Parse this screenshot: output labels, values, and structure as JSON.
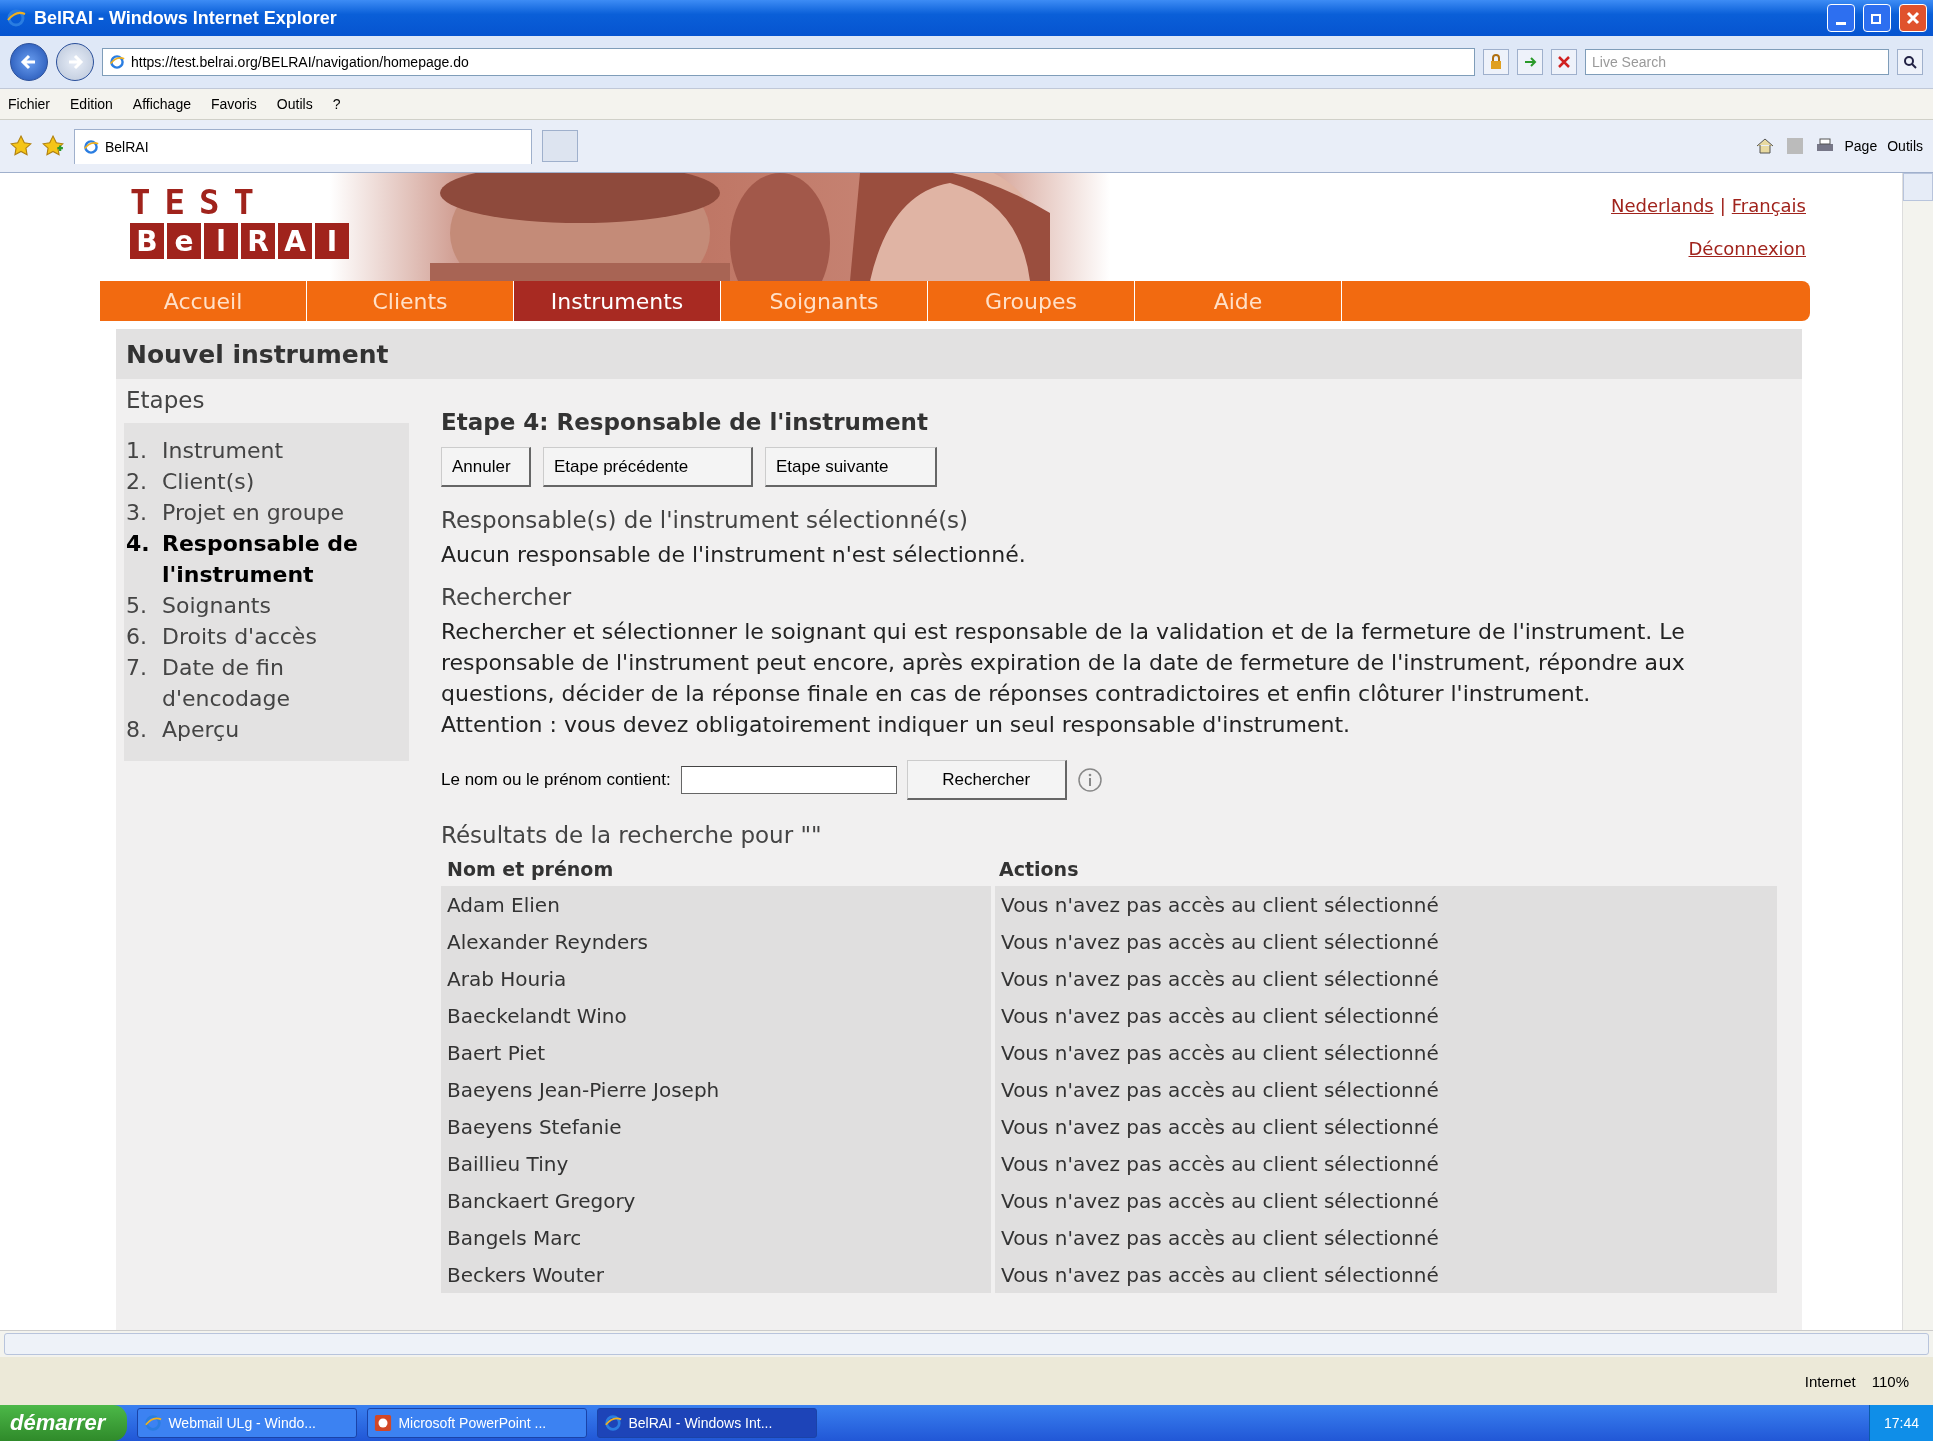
{
  "window": {
    "title": "BelRAI - Windows Internet Explorer"
  },
  "address_bar": {
    "url": "https://test.belrai.org/BELRAI/navigation/homepage.do",
    "search_placeholder": "Live Search"
  },
  "menu_bar": [
    "Fichier",
    "Edition",
    "Affichage",
    "Favoris",
    "Outils",
    "?"
  ],
  "tab": {
    "label": "BelRAI"
  },
  "command_bar": [
    "Page",
    "Outils"
  ],
  "page": {
    "logo": {
      "top": "TEST",
      "letters": [
        "B",
        "e",
        "l",
        "R",
        "A",
        "I"
      ]
    },
    "languages": [
      "Nederlands",
      "Français"
    ],
    "language_separator": "|",
    "logout": "Déconnexion",
    "nav": [
      {
        "label": "Accueil",
        "selected": false
      },
      {
        "label": "Clients",
        "selected": false
      },
      {
        "label": "Instruments",
        "selected": true
      },
      {
        "label": "Soignants",
        "selected": false
      },
      {
        "label": "Groupes",
        "selected": false
      },
      {
        "label": "Aide",
        "selected": false
      }
    ],
    "heading": "Nouvel instrument",
    "steps_title": "Etapes",
    "steps": [
      {
        "number": "1.",
        "label": "Instrument",
        "selected": false
      },
      {
        "number": "2.",
        "label": "Client(s)",
        "selected": false
      },
      {
        "number": "3.",
        "label": "Projet en groupe",
        "selected": false
      },
      {
        "number": "4.",
        "label": "Responsable de l'instrument",
        "selected": true
      },
      {
        "number": "5.",
        "label": "Soignants",
        "selected": false
      },
      {
        "number": "6.",
        "label": "Droits d'accès",
        "selected": false
      },
      {
        "number": "7.",
        "label": "Date de fin d'encodage",
        "selected": false
      },
      {
        "number": "8.",
        "label": "Aperçu",
        "selected": false
      }
    ],
    "step_title": "Etape 4: Responsable de l'instrument",
    "buttons": [
      "Annuler",
      "Etape précédente",
      "Etape suivante"
    ],
    "selected_title": "Responsable(s) de l'instrument sélectionné(s)",
    "selected_text": "Aucun responsable de l'instrument n'est sélectionné.",
    "search_title": "Rechercher",
    "description": "Rechercher et sélectionner le soignant qui est responsable de la validation et de la fermeture de l'instrument. Le responsable de l'instrument peut encore, après expiration de la date de fermeture de l'instrument, répondre aux questions, décider de la réponse finale en cas de réponses contradictoires et enfin clôturer l'instrument.",
    "attention": "Attention : vous devez obligatoirement indiquer un seul responsable d'instrument.",
    "search_label": "Le nom ou le prénom contient:",
    "search_button": "Rechercher",
    "results_title": "Résultats de la recherche pour \"\"",
    "table": {
      "columns": [
        "Nom et prénom",
        "Actions"
      ],
      "rows": [
        [
          "Adam Elien",
          "Vous n'avez pas accès au client sélectionné"
        ],
        [
          "Alexander Reynders",
          "Vous n'avez pas accès au client sélectionné"
        ],
        [
          "Arab Houria",
          "Vous n'avez pas accès au client sélectionné"
        ],
        [
          "Baeckelandt Wino",
          "Vous n'avez pas accès au client sélectionné"
        ],
        [
          "Baert Piet",
          "Vous n'avez pas accès au client sélectionné"
        ],
        [
          "Baeyens Jean-Pierre Joseph",
          "Vous n'avez pas accès au client sélectionné"
        ],
        [
          "Baeyens Stefanie",
          "Vous n'avez pas accès au client sélectionné"
        ],
        [
          "Baillieu Tiny",
          "Vous n'avez pas accès au client sélectionné"
        ],
        [
          "Banckaert Gregory",
          "Vous n'avez pas accès au client sélectionné"
        ],
        [
          "Bangels Marc",
          "Vous n'avez pas accès au client sélectionné"
        ],
        [
          "Beckers Wouter",
          "Vous n'avez pas accès au client sélectionné"
        ]
      ]
    }
  },
  "status_bar": {
    "zone": "Internet",
    "zoom": "110%"
  },
  "taskbar": {
    "start": "démarrer",
    "items": [
      {
        "label": "Webmail ULg - Windo...",
        "kind": "browser",
        "selected": false
      },
      {
        "label": "Microsoft PowerPoint ...",
        "kind": "slides",
        "selected": false
      },
      {
        "label": "BelRAI - Windows Int...",
        "kind": "browser",
        "selected": true
      }
    ],
    "clock": "17:44"
  }
}
